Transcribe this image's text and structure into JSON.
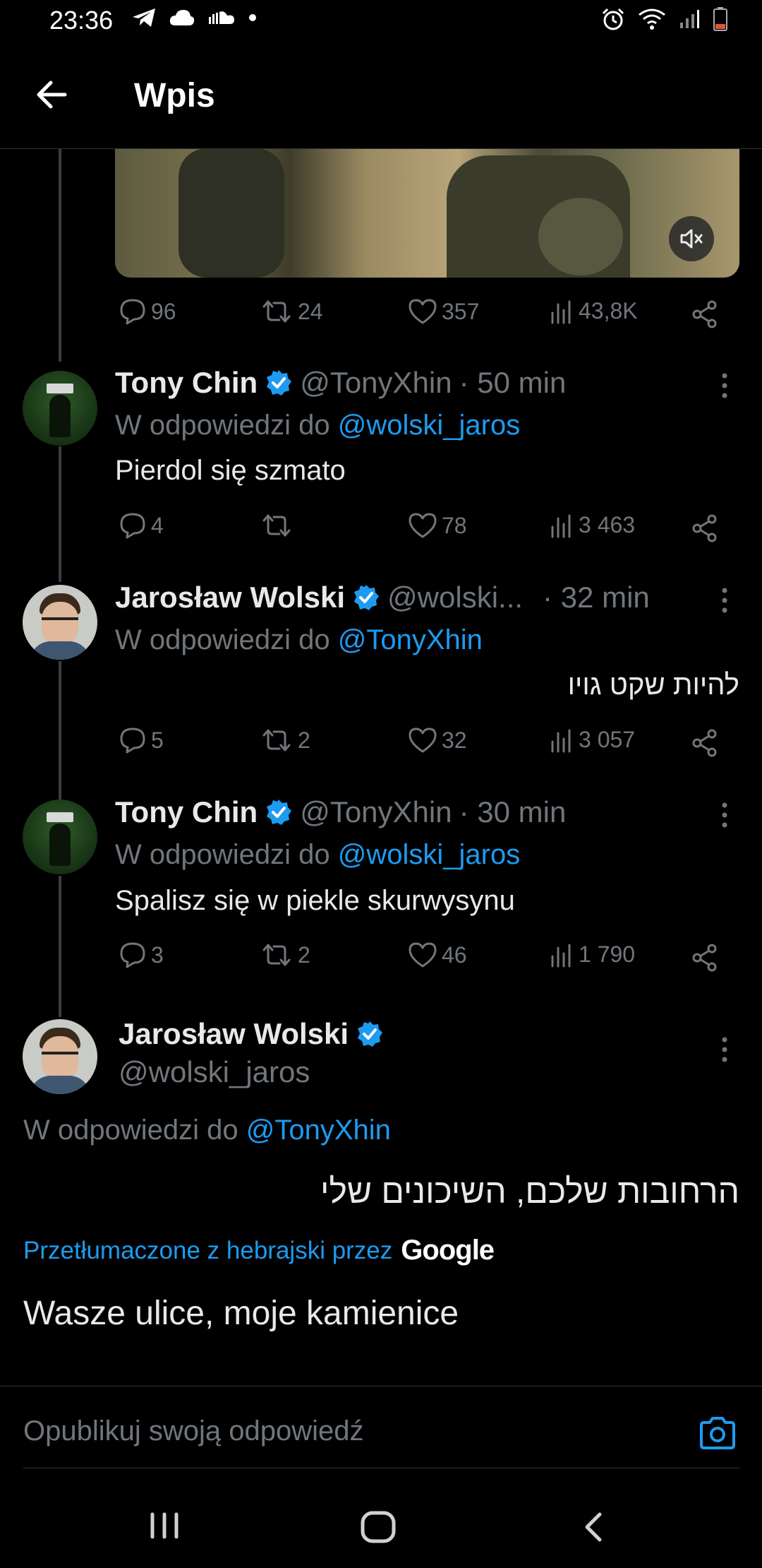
{
  "status_bar": {
    "time": "23:36"
  },
  "header": {
    "title": "Wpis"
  },
  "main_tweet_stats": {
    "replies": "96",
    "retweets": "24",
    "likes": "357",
    "views": "43,8K"
  },
  "replies": [
    {
      "name": "Tony Chin",
      "handle": "@TonyXhin",
      "time": "· 50 min",
      "reply_prefix": "W odpowiedzi do",
      "reply_to": "@wolski_jaros",
      "text": "Pierdol się szmato",
      "stats": {
        "replies": "4",
        "retweets": "",
        "likes": "78",
        "views": "3 463"
      }
    },
    {
      "name": "Jarosław Wolski",
      "handle": "@wolski...",
      "time": "· 32 min",
      "reply_prefix": "W odpowiedzi do",
      "reply_to": "@TonyXhin",
      "text": "להיות שקט גויו",
      "stats": {
        "replies": "5",
        "retweets": "2",
        "likes": "32",
        "views": "3 057"
      }
    },
    {
      "name": "Tony Chin",
      "handle": "@TonyXhin",
      "time": "· 30 min",
      "reply_prefix": "W odpowiedzi do",
      "reply_to": "@wolski_jaros",
      "text": "Spalisz się w piekle skurwysynu",
      "stats": {
        "replies": "3",
        "retweets": "2",
        "likes": "46",
        "views": "1 790"
      }
    }
  ],
  "focused_tweet": {
    "name": "Jarosław Wolski",
    "handle": "@wolski_jaros",
    "reply_prefix": "W odpowiedzi do",
    "reply_to": "@TonyXhin",
    "text": "הרחובות שלכם, השיכונים שלי",
    "translated_label": "Przetłumaczone z hebrajski przez",
    "translator": "Google",
    "translation": "Wasze ulice, moje kamienice"
  },
  "compose": {
    "placeholder": "Opublikuj swoją odpowiedź"
  },
  "colors": {
    "accent": "#1d9bf0",
    "background": "#000000",
    "muted": "#71767b"
  }
}
